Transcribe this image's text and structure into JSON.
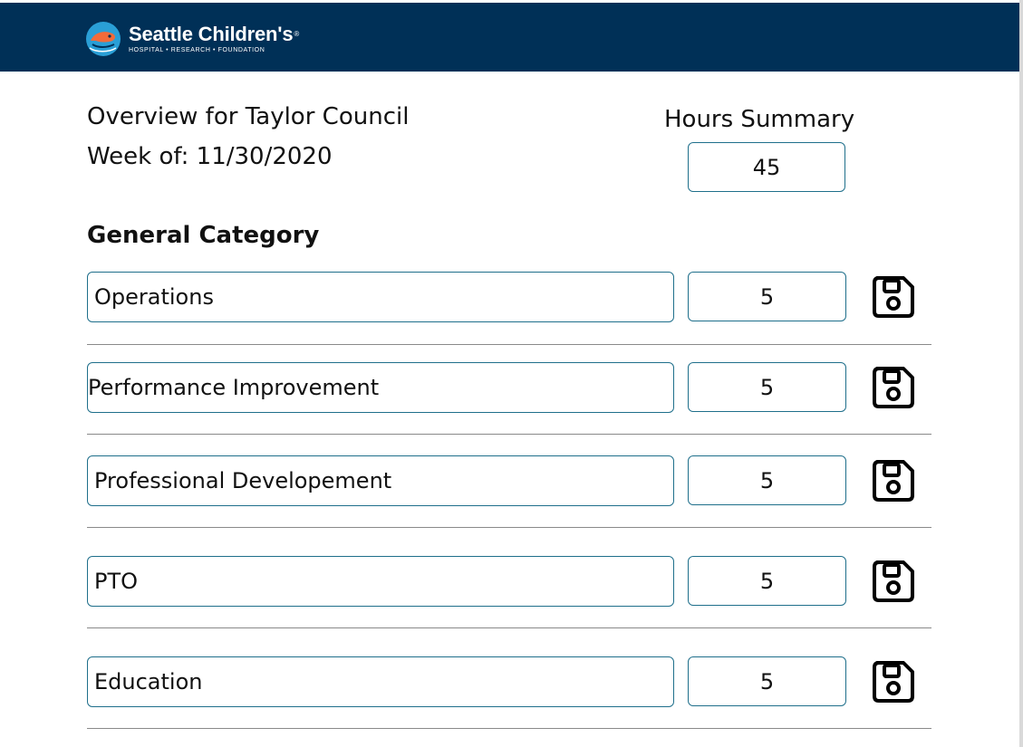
{
  "header": {
    "brand_name": "Seattle Children's",
    "brand_mark": "®",
    "brand_tagline": "HOSPITAL • RESEARCH • FOUNDATION",
    "bar_color": "#003057",
    "accent_color": "#2a9fd6",
    "logo_icon": "whale-icon"
  },
  "overview": {
    "title": "Overview for Taylor Council",
    "week": "Week of: 11/30/2020"
  },
  "hours_summary": {
    "label": "Hours Summary",
    "value": "45"
  },
  "section": {
    "title": "General Category"
  },
  "categories": [
    {
      "name": "Operations",
      "hours": "5"
    },
    {
      "name": "Performance Improvement",
      "hours": "5"
    },
    {
      "name": "Professional Developement",
      "hours": "5"
    },
    {
      "name": "PTO",
      "hours": "5"
    },
    {
      "name": "Education",
      "hours": "5"
    }
  ],
  "row_icon": "save-icon",
  "box_border_color": "#1f6f8b"
}
